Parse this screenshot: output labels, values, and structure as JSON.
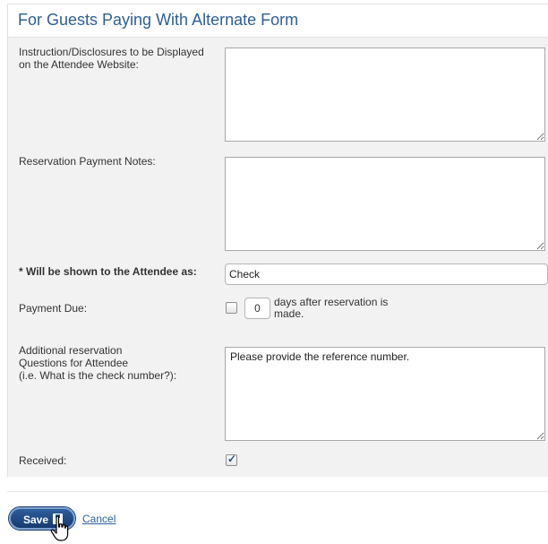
{
  "panel": {
    "title": "For Guests Paying With Alternate Form"
  },
  "form": {
    "instructions_label_line1": "Instruction/Disclosures to be Displayed",
    "instructions_label_line2": "on the Attendee Website:",
    "instructions_value": "",
    "payment_notes_label": "Reservation Payment Notes:",
    "payment_notes_value": "",
    "shown_as_label": "* Will be shown to the Attendee as:",
    "shown_as_value": "Check",
    "payment_due_label": "Payment Due:",
    "payment_due_checked": false,
    "payment_due_days": "0",
    "payment_due_text_line1": "days after reservation is",
    "payment_due_text_line2": "made.",
    "questions_label_line1": "Additional reservation",
    "questions_label_line2": "Questions for Attendee",
    "questions_label_line3": "(i.e. What is the check number?):",
    "questions_value": "Please provide the reference number.",
    "received_label": "Received:",
    "received_checked": true
  },
  "actions": {
    "save_label": "Save",
    "cancel_label": "Cancel"
  },
  "colors": {
    "title": "#2d5f9a",
    "panel_bg": "#f2f2f2",
    "save_button": "#1f4a85",
    "link": "#2d5f9a"
  }
}
